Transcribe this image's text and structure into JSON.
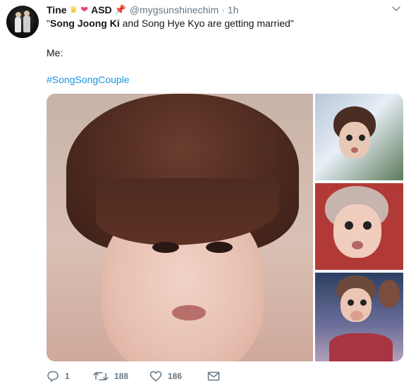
{
  "tweet": {
    "display_name": "Tine",
    "name_suffix": "ASD",
    "emojis": [
      "crown-emoji",
      "hearts-emoji",
      "pushpin-emoji"
    ],
    "handle": "@mygsunshinechim",
    "separator": "·",
    "time": "1h",
    "quote_open": "\"",
    "quote_bold": "Song Joong Ki",
    "quote_rest": " and Song Hye Kyo are getting married\"",
    "line2": "Me:",
    "hashtag": "#SongSongCouple",
    "media": [
      "large-photo",
      "thumbnail-1",
      "thumbnail-2",
      "thumbnail-3"
    ]
  },
  "actions": {
    "reply_count": "1",
    "retweet_count": "188",
    "like_count": "186"
  },
  "colors": {
    "text": "#14171a",
    "muted": "#657786",
    "link": "#1b95e0"
  }
}
